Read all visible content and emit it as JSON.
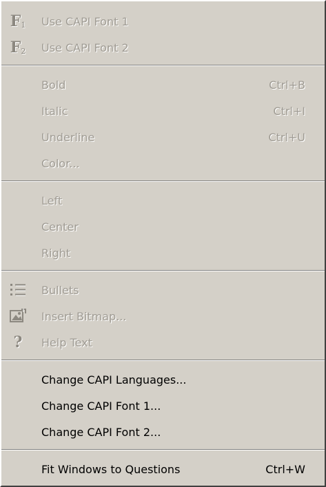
{
  "menu": {
    "font_items": [
      {
        "label": "Use CAPI Font 1",
        "icon": "font-1-icon"
      },
      {
        "label": "Use CAPI Font 2",
        "icon": "font-2-icon"
      }
    ],
    "format_items": [
      {
        "label": "Bold",
        "shortcut": "Ctrl+B"
      },
      {
        "label": "Italic",
        "shortcut": "Ctrl+I"
      },
      {
        "label": "Underline",
        "shortcut": "Ctrl+U"
      },
      {
        "label": "Color...",
        "shortcut": ""
      }
    ],
    "align_items": [
      {
        "label": "Left"
      },
      {
        "label": "Center"
      },
      {
        "label": "Right"
      }
    ],
    "insert_items": [
      {
        "label": "Bullets",
        "icon": "bullets-icon"
      },
      {
        "label": "Insert Bitmap...",
        "icon": "insert-bitmap-icon"
      },
      {
        "label": "Help Text",
        "icon": "help-icon"
      }
    ],
    "change_items": [
      {
        "label": "Change CAPI Languages..."
      },
      {
        "label": "Change CAPI Font 1..."
      },
      {
        "label": "Change CAPI Font 2..."
      }
    ],
    "fit_item": {
      "label": "Fit Windows to Questions",
      "shortcut": "Ctrl+W"
    },
    "glyphs": {
      "font_letter": "F",
      "font_1_sub": "1",
      "font_2_sub": "2",
      "help": "?"
    },
    "colors": {
      "menu_bg": "#d4d0c8",
      "disabled_text": "#a09c94",
      "enabled_text": "#000000"
    }
  }
}
